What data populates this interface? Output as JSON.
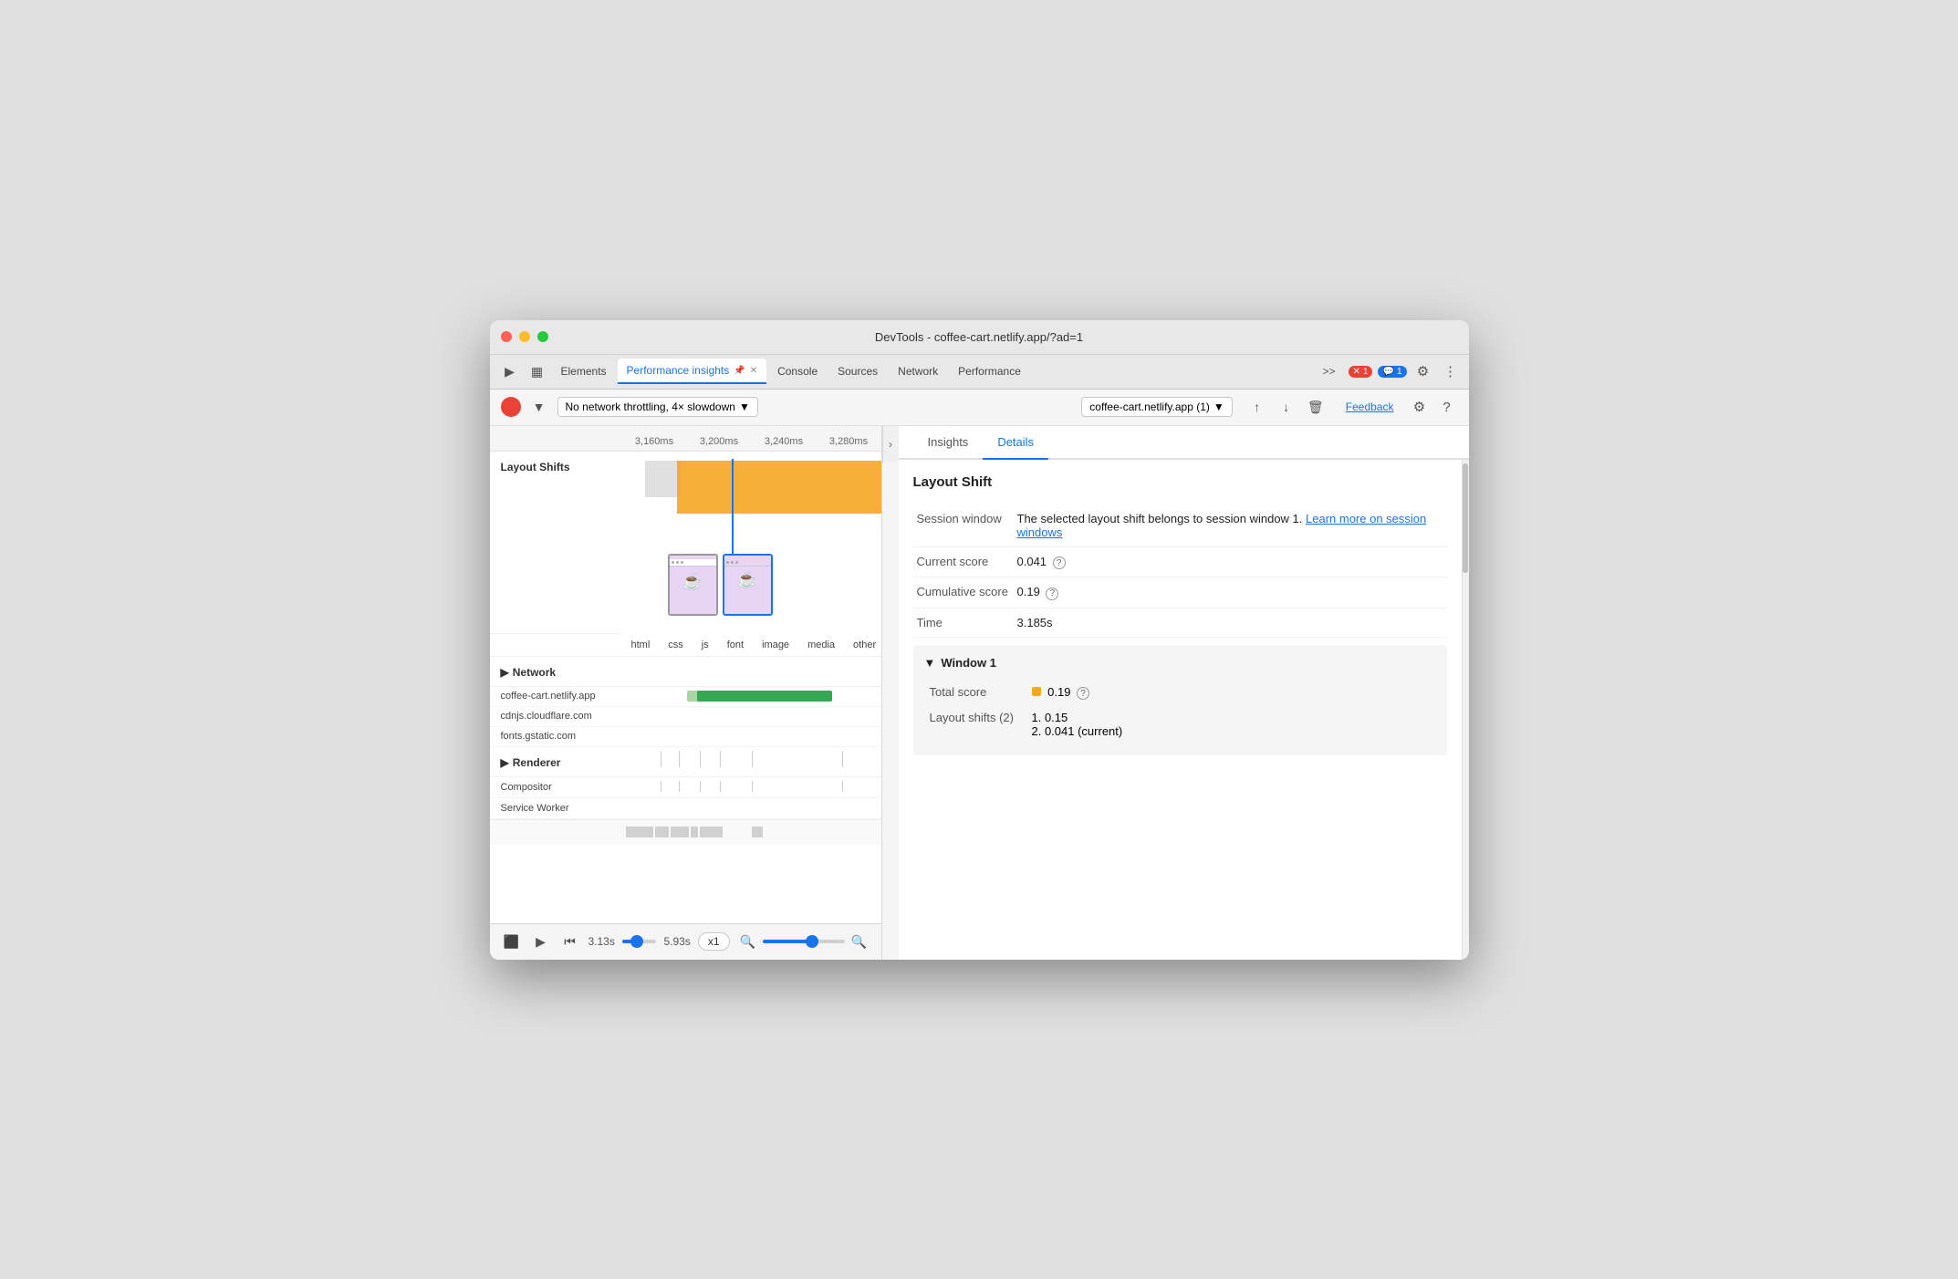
{
  "titlebar": {
    "title": "DevTools - coffee-cart.netlify.app/?ad=1"
  },
  "tabs": {
    "items": [
      {
        "label": "Elements",
        "active": false
      },
      {
        "label": "Performance insights",
        "active": true,
        "pinned": true
      },
      {
        "label": "Console",
        "active": false
      },
      {
        "label": "Sources",
        "active": false
      },
      {
        "label": "Network",
        "active": false
      },
      {
        "label": "Performance",
        "active": false
      }
    ],
    "error_badge": "1",
    "message_badge": "1",
    "more": ">>"
  },
  "toolbar": {
    "throttling": "No network throttling, 4× slowdown",
    "url": "coffee-cart.netlify.app (1)",
    "feedback_label": "Feedback"
  },
  "timeline": {
    "marks": [
      "3,160ms",
      "3,200ms",
      "3,240ms",
      "3,280ms"
    ]
  },
  "sections": {
    "layout_shifts_label": "Layout Shifts",
    "network_label": "Network",
    "renderer_label": "Renderer",
    "compositor_label": "Compositor",
    "service_worker_label": "Service Worker"
  },
  "legend": {
    "items": [
      {
        "label": "html",
        "color": "#4285f4"
      },
      {
        "label": "css",
        "color": "#a142f4"
      },
      {
        "label": "js",
        "color": "#f5a623"
      },
      {
        "label": "font",
        "color": "#4285f4"
      },
      {
        "label": "image",
        "color": "#34a853"
      },
      {
        "label": "media",
        "color": "#0f9d58"
      },
      {
        "label": "other",
        "color": "#c8c8c8"
      }
    ]
  },
  "network_rows": [
    {
      "label": "coffee-cart.netlify.app",
      "bar_left": "28%",
      "bar_width": "55%",
      "color": "#34a853"
    },
    {
      "label": "cdnjs.cloudflare.com",
      "bar_left": "0",
      "bar_width": "0",
      "color": "#transparent"
    },
    {
      "label": "fonts.gstatic.com",
      "bar_left": "0",
      "bar_width": "0",
      "color": "#transparent"
    }
  ],
  "bottom_bar": {
    "time_start": "3.13s",
    "time_end": "5.93s",
    "speed": "x1"
  },
  "right_panel": {
    "tabs": [
      "Insights",
      "Details"
    ],
    "active_tab": "Details",
    "details": {
      "section_title": "Layout Shift",
      "rows": [
        {
          "label": "Session window",
          "value": "The selected layout shift belongs to session window 1.",
          "link": "Learn more on session windows"
        },
        {
          "label": "Current score",
          "value": "0.041",
          "has_help": true
        },
        {
          "label": "Cumulative score",
          "value": "0.19",
          "has_help": true
        },
        {
          "label": "Time",
          "value": "3.185s"
        }
      ],
      "window1": {
        "title": "Window 1",
        "total_score": "0.19",
        "layout_shifts_label": "Layout shifts (2)",
        "shift1": "1. 0.15",
        "shift2": "2. 0.041 (current)"
      }
    }
  }
}
